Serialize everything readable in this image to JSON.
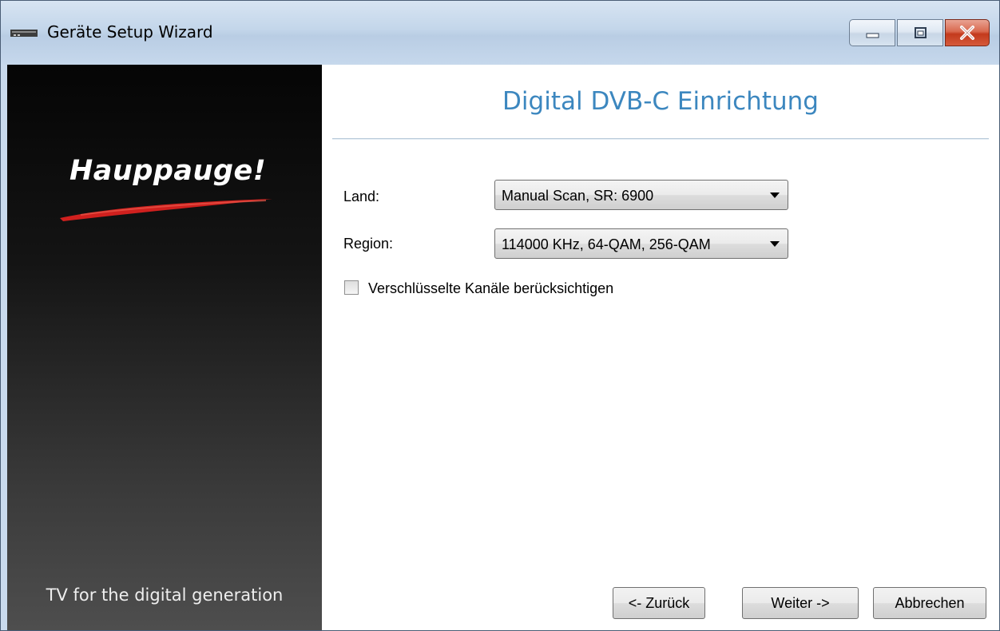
{
  "window": {
    "title": "Geräte Setup Wizard"
  },
  "sidebar": {
    "logo": "Hauppauge!",
    "tagline": "TV for the digital generation"
  },
  "main": {
    "heading": "Digital DVB-C Einrichtung",
    "land": {
      "label": "Land:",
      "value": "Manual Scan, SR: 6900"
    },
    "region": {
      "label": "Region:",
      "value": "114000 KHz, 64-QAM, 256-QAM"
    },
    "encrypted_channels": {
      "label": "Verschlüsselte Kanäle berücksichtigen",
      "checked": false
    }
  },
  "buttons": {
    "back": "<- Zurück",
    "next": "Weiter ->",
    "cancel": "Abbrechen"
  },
  "colors": {
    "heading": "#3c87bf",
    "sidebar_top": "#050505",
    "sidebar_bottom": "#4e4e4e",
    "logo_swoosh": "#d0201e"
  }
}
